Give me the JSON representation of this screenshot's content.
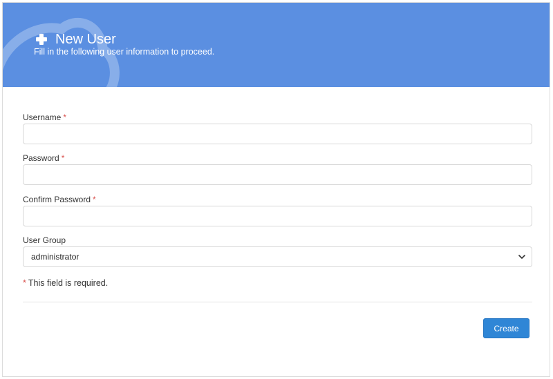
{
  "header": {
    "title": "New User",
    "subtitle": "Fill in the following user information to proceed.",
    "background_color": "#5b8fe1",
    "icon": "plus-icon"
  },
  "form": {
    "username": {
      "label": "Username",
      "required_mark": "*",
      "value": ""
    },
    "password": {
      "label": "Password",
      "required_mark": "*",
      "value": ""
    },
    "confirm_password": {
      "label": "Confirm Password",
      "required_mark": "*",
      "value": ""
    },
    "user_group": {
      "label": "User Group",
      "selected": "administrator",
      "icon": "chevron-down-icon"
    },
    "required_note": {
      "mark": "*",
      "text": "This field is required."
    }
  },
  "actions": {
    "create_label": "Create",
    "create_color": "#2f86d6"
  },
  "colors": {
    "required": "#d9534f"
  }
}
